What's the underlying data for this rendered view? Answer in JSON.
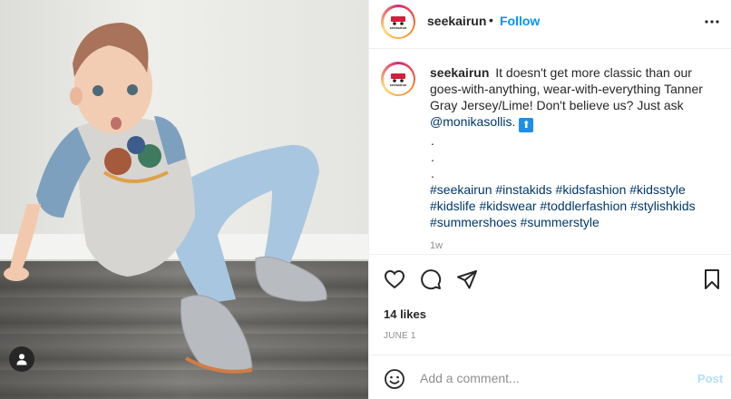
{
  "post": {
    "username": "seekairun",
    "follow_label": "Follow",
    "separator": "•",
    "avatar_logo_text": "seekairun"
  },
  "caption": {
    "username": "seekairun",
    "text_before_mention": "It doesn't get more classic than our goes-with-anything, wear-with-everything Tanner Gray Jersey/Lime! Don't believe us? Just ask",
    "mention": "@monikasollis",
    "after_mention": ".",
    "emoji": "⬆",
    "dots": [
      ".",
      ".",
      "."
    ],
    "hashtags": [
      "#seekairun",
      "#instakids",
      "#kidsfashion",
      "#kidsstyle",
      "#kidslife",
      "#kidswear",
      "#toddlerfashion",
      "#stylishkids",
      "#summershoes",
      "#summerstyle"
    ],
    "age": "1w"
  },
  "actions": {
    "like_icon": "heart-icon",
    "comment_icon": "comment-icon",
    "share_icon": "share-icon",
    "save_icon": "bookmark-icon"
  },
  "likes": "14 likes",
  "date": "JUNE 1",
  "comment": {
    "placeholder": "Add a comment...",
    "post_label": "Post"
  },
  "colors": {
    "follow": "#0095f6",
    "link": "#00376b",
    "muted": "#8e8e8e",
    "post_disabled": "#b2dffc"
  }
}
